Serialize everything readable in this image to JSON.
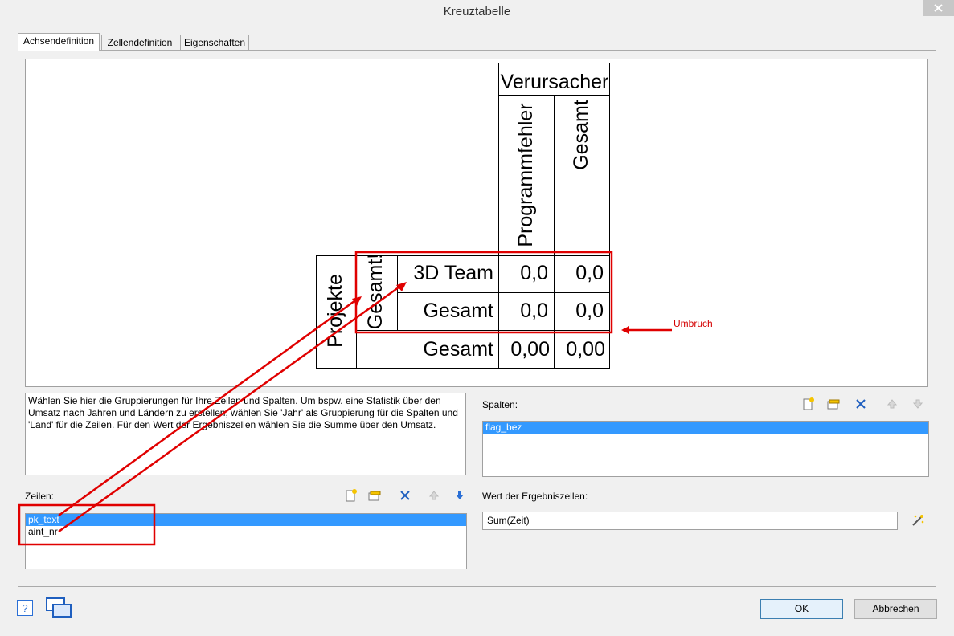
{
  "window": {
    "title": "Kreuztabelle"
  },
  "tabs": [
    {
      "label": "Achsendefinition",
      "active": true
    },
    {
      "label": "Zellendefinition",
      "active": false
    },
    {
      "label": "Eigenschaften",
      "active": false
    }
  ],
  "preview": {
    "column_group": "Verursacher",
    "column_headers": [
      "Programmfehler",
      "Gesamt"
    ],
    "row_group": "Projekte",
    "row_subgroup": "Gesamt!",
    "row_labels": [
      "3D Team",
      "Gesamt"
    ],
    "cells": [
      [
        "0,0",
        "0,0"
      ],
      [
        "0,0",
        "0,0"
      ]
    ],
    "total_label": "Gesamt",
    "total_values": [
      "0,00",
      "0,00"
    ]
  },
  "description": "Wählen Sie hier die Gruppierungen für Ihre Zeilen und Spalten. Um bspw. eine Statistik über den Umsatz nach Jahren und Ländern zu erstellen, wählen Sie 'Jahr' als Gruppierung für die Spalten und 'Land' für die Zeilen. Für den Wert der Ergebniszellen wählen Sie die Summe über den Umsatz.",
  "zeilen": {
    "label": "Zeilen:",
    "items": [
      "pk_text",
      "aint_nr"
    ],
    "selected_index": 0
  },
  "spalten": {
    "label": "Spalten:",
    "items": [
      "flag_bez"
    ],
    "selected_index": 0
  },
  "wert": {
    "label": "Wert der Ergebniszellen:",
    "value": "Sum(Zeit)"
  },
  "buttons": {
    "ok": "OK",
    "cancel": "Abbrechen"
  },
  "annotation": {
    "label": "Umbruch",
    "color": "#e00000"
  },
  "colors": {
    "selection": "#3399ff",
    "delete": "#1f5fbf",
    "arrow_down": "#2a6fd6"
  }
}
